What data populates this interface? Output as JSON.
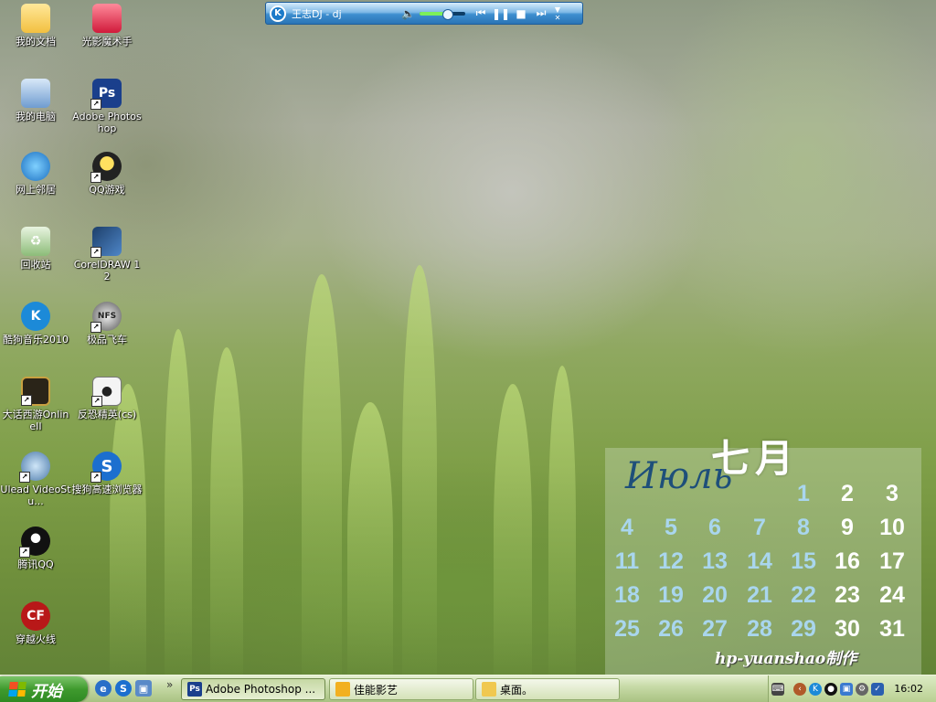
{
  "desktop": {
    "icons": [
      {
        "label": "我的文档"
      },
      {
        "label": "光影魔术手"
      },
      {
        "label": "我的电脑"
      },
      {
        "label": "Adobe Photoshop"
      },
      {
        "label": "网上邻居"
      },
      {
        "label": "QQ游戏"
      },
      {
        "label": "回收站"
      },
      {
        "label": "CorelDRAW 12"
      },
      {
        "label": "酷狗音乐2010"
      },
      {
        "label": "极品飞车"
      },
      {
        "label": "大话西游OnlineII"
      },
      {
        "label": "反恐精英(cs)"
      },
      {
        "label": "Ulead VideoStu..."
      },
      {
        "label": "搜狗高速浏览器"
      },
      {
        "label": "腾讯QQ"
      },
      {
        "label": "穿越火线"
      }
    ]
  },
  "player": {
    "title": "王志DJ - dj",
    "volume_level": 0.6
  },
  "calendar": {
    "month_cn": "七月",
    "month_ru": "Июль",
    "days_dim": [
      "1",
      "4",
      "5",
      "6",
      "7",
      "8",
      "11",
      "12",
      "13",
      "14",
      "15",
      "18",
      "19",
      "20",
      "21",
      "22",
      "25",
      "26",
      "27",
      "28",
      "29"
    ],
    "days_bright": [
      "2",
      "3",
      "9",
      "10",
      "16",
      "17",
      "23",
      "24",
      "30",
      "31"
    ],
    "credit": "hp-yuanshao制作"
  },
  "taskbar": {
    "start_label": "开始",
    "tasks": [
      {
        "label": "Adobe Photoshop ..."
      },
      {
        "label": "佳能影艺"
      },
      {
        "label": "桌面。"
      }
    ],
    "clock": "16:02"
  },
  "colors": {
    "accent": "#3f9a2e",
    "calendar_dim": "#a9d6ee",
    "calendar_month": "#1e4f7a"
  }
}
